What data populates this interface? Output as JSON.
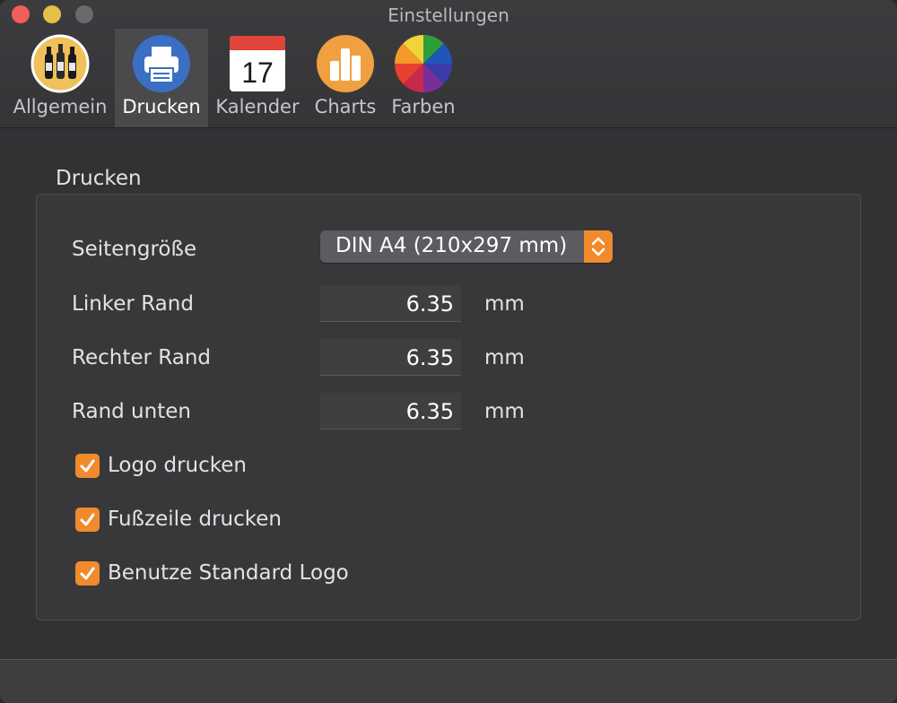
{
  "window": {
    "title": "Einstellungen"
  },
  "toolbar": {
    "tabs": [
      {
        "label": "Allgemein",
        "icon": "wine-bottles-icon",
        "selected": false
      },
      {
        "label": "Drucken",
        "icon": "printer-icon",
        "selected": true
      },
      {
        "label": "Kalender",
        "icon": "calendar-icon",
        "selected": false,
        "icon_text": "17"
      },
      {
        "label": "Charts",
        "icon": "bar-chart-icon",
        "selected": false
      },
      {
        "label": "Farben",
        "icon": "color-wheel-icon",
        "selected": false
      }
    ]
  },
  "print": {
    "group_title": "Drucken",
    "page_size": {
      "label": "Seitengröße",
      "value": "DIN A4 (210x297 mm)"
    },
    "left_margin": {
      "label": "Linker Rand",
      "value": "6.35",
      "unit": "mm"
    },
    "right_margin": {
      "label": "Rechter Rand",
      "value": "6.35",
      "unit": "mm"
    },
    "bottom_margin": {
      "label": "Rand unten",
      "value": "6.35",
      "unit": "mm"
    },
    "checkboxes": [
      {
        "label": "Logo drucken",
        "checked": true
      },
      {
        "label": "Fußzeile drucken",
        "checked": true
      },
      {
        "label": "Benutze Standard Logo",
        "checked": true
      }
    ]
  },
  "colors": {
    "accent": "#f08a2c",
    "background": "#323235"
  }
}
